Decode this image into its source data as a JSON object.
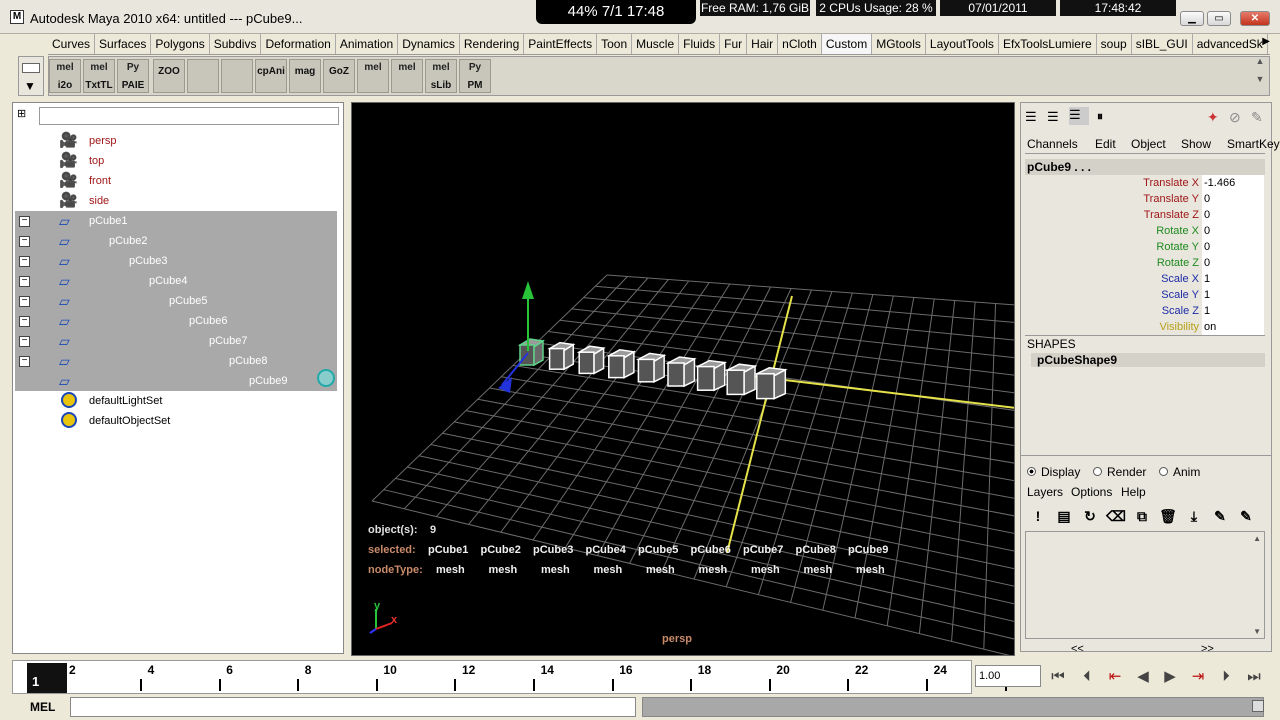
{
  "window": {
    "title": "Autodesk Maya 2010 x64: untitled   ---   pCube9...",
    "overlay": "44%  7/1   17:48",
    "status": [
      {
        "label": "Free RAM: 1,76 GiB"
      },
      {
        "label": "2 CPUs Usage: 28 %"
      },
      {
        "label": "07/01/2011"
      },
      {
        "label": "17:48:42"
      }
    ]
  },
  "shelf": {
    "tabs": [
      "Curves",
      "Surfaces",
      "Polygons",
      "Subdivs",
      "Deformation",
      "Animation",
      "Dynamics",
      "Rendering",
      "PaintEffects",
      "Toon",
      "Muscle",
      "Fluids",
      "Fur",
      "Hair",
      "nCloth",
      "Custom",
      "MGtools",
      "LayoutTools",
      "EfxToolsLumiere",
      "soup",
      "sIBL_GUI",
      "advancedSk"
    ],
    "active_tab": "Custom",
    "icons": [
      {
        "top": "mel",
        "bottom": "i2o"
      },
      {
        "top": "mel",
        "bottom": "TxtTL"
      },
      {
        "top": "Py",
        "bottom": "PAIE"
      },
      {
        "top": "",
        "bottom": "ZOO"
      },
      {
        "top": "",
        "bottom": ""
      },
      {
        "top": "",
        "bottom": ""
      },
      {
        "top": "",
        "bottom": "cpAni"
      },
      {
        "top": "",
        "bottom": "mag"
      },
      {
        "top": "",
        "bottom": "GoZ"
      },
      {
        "top": "mel",
        "bottom": ""
      },
      {
        "top": "mel",
        "bottom": ""
      },
      {
        "top": "mel",
        "bottom": "sLib"
      },
      {
        "top": "Py",
        "bottom": "PM"
      }
    ]
  },
  "outliner": {
    "cameras": [
      "persp",
      "top",
      "front",
      "side"
    ],
    "cubes": [
      "pCube1",
      "pCube2",
      "pCube3",
      "pCube4",
      "pCube5",
      "pCube6",
      "pCube7",
      "pCube8",
      "pCube9"
    ],
    "sets": [
      "defaultLightSet",
      "defaultObjectSet"
    ]
  },
  "viewport": {
    "camera_label": "persp",
    "hud": {
      "objects_label": "object(s):",
      "objects_value": "9",
      "selected_label": "selected:",
      "selected": [
        "pCube1",
        "pCube2",
        "pCube3",
        "pCube4",
        "pCube5",
        "pCube6",
        "pCube7",
        "pCube8",
        "pCube9"
      ],
      "nodetype_label": "nodeType:",
      "nodetypes": [
        "mesh",
        "mesh",
        "mesh",
        "mesh",
        "mesh",
        "mesh",
        "mesh",
        "mesh",
        "mesh"
      ]
    },
    "axis": {
      "y": "y",
      "x": "x"
    }
  },
  "channelbox": {
    "menu": [
      "Channels",
      "Edit",
      "Object",
      "Show",
      "SmartKey"
    ],
    "object": "pCube9 . . .",
    "channels": [
      {
        "name": "Translate X",
        "value": "-1.466",
        "color": "#a01818"
      },
      {
        "name": "Translate Y",
        "value": "0",
        "color": "#a01818"
      },
      {
        "name": "Translate Z",
        "value": "0",
        "color": "#a01818"
      },
      {
        "name": "Rotate X",
        "value": "0",
        "color": "#1f8a1f"
      },
      {
        "name": "Rotate Y",
        "value": "0",
        "color": "#1f8a1f"
      },
      {
        "name": "Rotate Z",
        "value": "0",
        "color": "#1f8a1f"
      },
      {
        "name": "Scale X",
        "value": "1",
        "color": "#1e2ca8"
      },
      {
        "name": "Scale Y",
        "value": "1",
        "color": "#1e2ca8"
      },
      {
        "name": "Scale Z",
        "value": "1",
        "color": "#1e2ca8"
      },
      {
        "name": "Visibility",
        "value": "on",
        "color": "#b8a018"
      }
    ],
    "shapes_label": "SHAPES",
    "shape_name": "pCubeShape9"
  },
  "layers": {
    "radio": [
      "Display",
      "Render",
      "Anim"
    ],
    "radio_selected": "Display",
    "menu": [
      "Layers",
      "Options",
      "Help"
    ],
    "scroll_left": "<<",
    "scroll_right": ">>"
  },
  "timeline": {
    "current_frame": "1",
    "labels": [
      "2",
      "4",
      "6",
      "8",
      "10",
      "12",
      "14",
      "16",
      "18",
      "20",
      "22",
      "24"
    ],
    "frame_field": "1.00"
  },
  "cmd": {
    "label": "MEL"
  }
}
